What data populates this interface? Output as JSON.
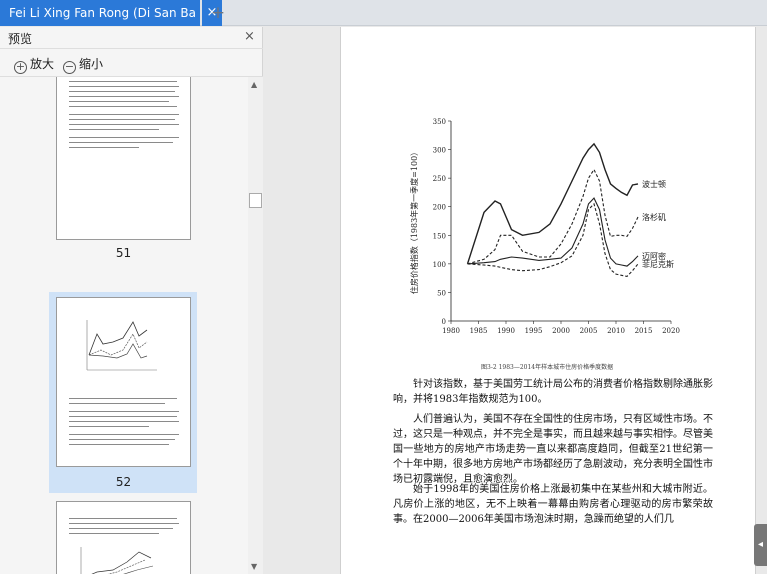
{
  "tab": {
    "title": "Fei Li Xing Fan Rong (Di San Ba",
    "close": "×",
    "add": "+"
  },
  "sidebar": {
    "title": "预览",
    "close": "×",
    "zoom_in": "放大",
    "zoom_out": "缩小",
    "pages": [
      {
        "label": "51"
      },
      {
        "label": "52"
      }
    ]
  },
  "document": {
    "chart_data": {
      "type": "line",
      "ylabel": "住房价格指数（1983年第一季度=100）",
      "xlim": [
        1980,
        2020
      ],
      "ylim": [
        0,
        350
      ],
      "xticks": [
        1980,
        1985,
        1990,
        1995,
        2000,
        2005,
        2010,
        2015,
        2020
      ],
      "yticks": [
        0,
        50,
        100,
        150,
        200,
        250,
        300,
        350
      ],
      "x": [
        1983,
        1986,
        1988,
        1989,
        1991,
        1993,
        1996,
        1998,
        2000,
        2002,
        2004,
        2005,
        2006,
        2007,
        2008,
        2009,
        2010,
        2011,
        2012,
        2013,
        2014
      ],
      "series": [
        {
          "name": "波士顿",
          "style": "solid",
          "values": [
            100,
            190,
            210,
            205,
            160,
            150,
            155,
            170,
            205,
            245,
            285,
            300,
            310,
            295,
            265,
            240,
            232,
            225,
            220,
            238,
            240
          ]
        },
        {
          "name": "洛杉矶",
          "style": "dashed",
          "values": [
            100,
            108,
            125,
            150,
            150,
            122,
            112,
            112,
            135,
            170,
            218,
            250,
            265,
            245,
            185,
            148,
            150,
            150,
            148,
            162,
            182
          ]
        },
        {
          "name": "迈阿密",
          "style": "solid",
          "values": [
            100,
            102,
            104,
            108,
            112,
            110,
            106,
            108,
            110,
            128,
            170,
            205,
            215,
            195,
            142,
            110,
            100,
            98,
            96,
            104,
            114
          ]
        },
        {
          "name": "菲尼克斯",
          "style": "dashed",
          "values": [
            100,
            98,
            96,
            94,
            90,
            88,
            90,
            95,
            102,
            114,
            150,
            195,
            205,
            170,
            118,
            90,
            82,
            80,
            78,
            88,
            100
          ]
        }
      ]
    },
    "figure_caption": "图3-2 1983—2014年样本城市住房价格季度数据",
    "paragraphs": [
      "针对该指数，基于美国劳工统计局公布的消费者价格指数剔除通胀影响，并将1983年指数规范为100。",
      "人们普遍认为，美国不存在全国性的住房市场，只有区域性市场。不过，这只是一种观点，并不完全是事实，而且越来越与事实相悖。尽管美国一些地方的房地产市场走势一直以来都高度趋同，但截至21世纪第一个十年中期，很多地方房地产市场都经历了急剧波动，充分表明全国性市场已初露端倪，且愈演愈烈。",
      "始于1998年的美国住房价格上涨最初集中在某些州和大城市附近。凡房价上涨的地区，无不上映着一幕幕由购房者心理驱动的房市繁荣故事。在2000—2006年美国市场泡沫时期，急躁而绝望的人们几"
    ]
  }
}
